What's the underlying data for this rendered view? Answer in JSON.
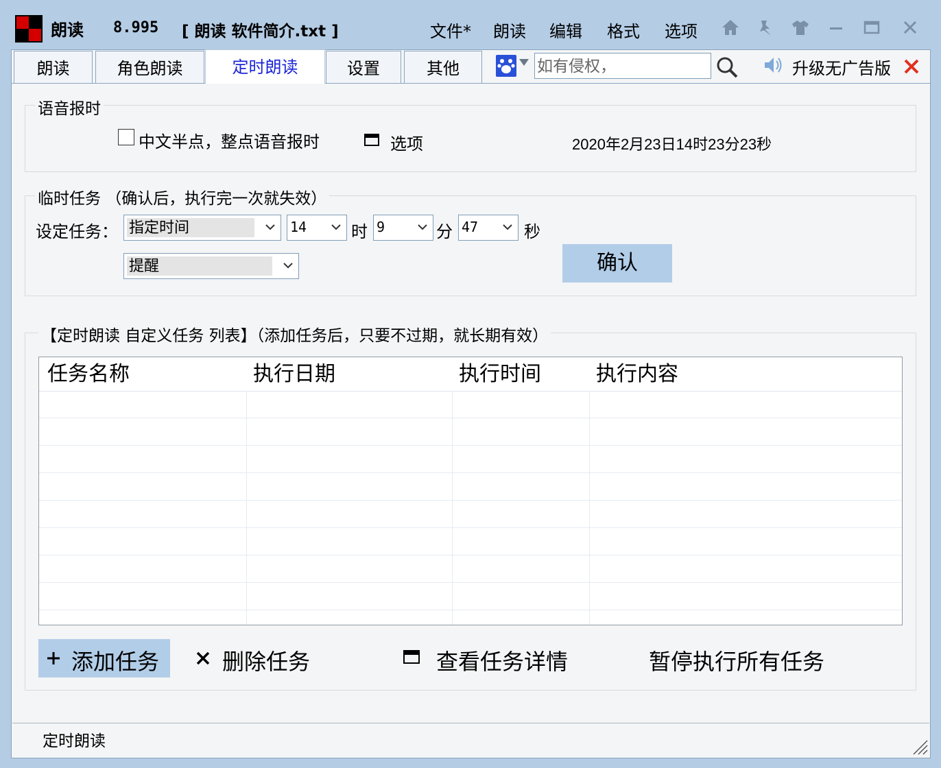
{
  "titlebar": {
    "app_name": "朗读",
    "version": "8.995",
    "doc_title": "[ 朗读  软件简介.txt ]",
    "menu": [
      "文件*",
      "朗读",
      "编辑",
      "格式",
      "选项"
    ]
  },
  "tabs": {
    "items": [
      "朗读",
      "角色朗读",
      "定时朗读",
      "设置",
      "其他"
    ],
    "active": "定时朗读"
  },
  "search": {
    "placeholder": "如有侵权，",
    "upgrade_label": "升级无广告版"
  },
  "voice_time": {
    "group_label": "语音报时",
    "checkbox_label": "中文半点，整点语音报时",
    "checked": false,
    "options_label": "选项",
    "current_datetime": "2020年2月23日14时23分23秒"
  },
  "temp_task": {
    "group_label": "临时任务  （确认后，执行完一次就失效）",
    "set_label": "设定任务：",
    "mode_value": "指定时间",
    "hour_value": "14",
    "hour_unit": "时",
    "minute_value": "9",
    "minute_unit": "分",
    "second_value": "47",
    "second_unit": "秒",
    "action_value": "提醒",
    "confirm_label": "确认"
  },
  "task_list": {
    "group_label": "【定时朗读  自定义任务 列表】（添加任务后，只要不过期，就长期有效）",
    "columns": [
      "任务名称",
      "执行日期",
      "执行时间",
      "执行内容"
    ],
    "rows": []
  },
  "actions": {
    "add": "添加任务",
    "delete": "删除任务",
    "details": "查看任务详情",
    "pause_all": "暂停执行所有任务"
  },
  "status": {
    "text": "定时朗读"
  },
  "colors": {
    "window_frame": "#b4cce4",
    "accent_button": "#b2cde8",
    "active_tab_text": "#1c25d6",
    "close_red": "#e0301e",
    "paw_blue": "#2a50d8"
  }
}
